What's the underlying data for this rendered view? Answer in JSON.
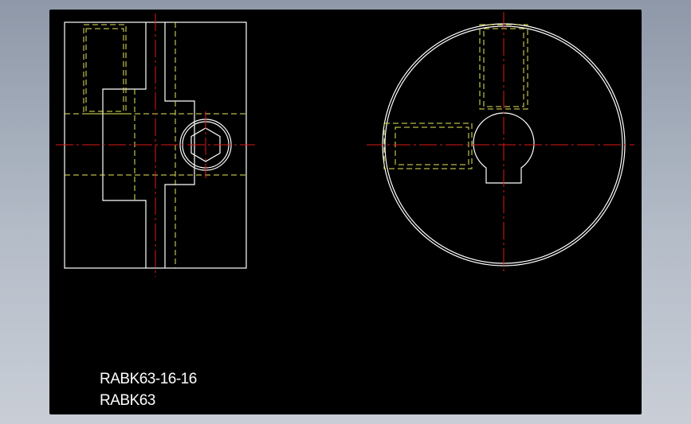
{
  "drawing": {
    "title_line1": "RABK63-16-16",
    "title_line2": "RABK63"
  },
  "colors": {
    "background": "#000000",
    "outline": "#ffffff",
    "hidden_line": "#e8e85a",
    "center_line": "#e01818"
  }
}
